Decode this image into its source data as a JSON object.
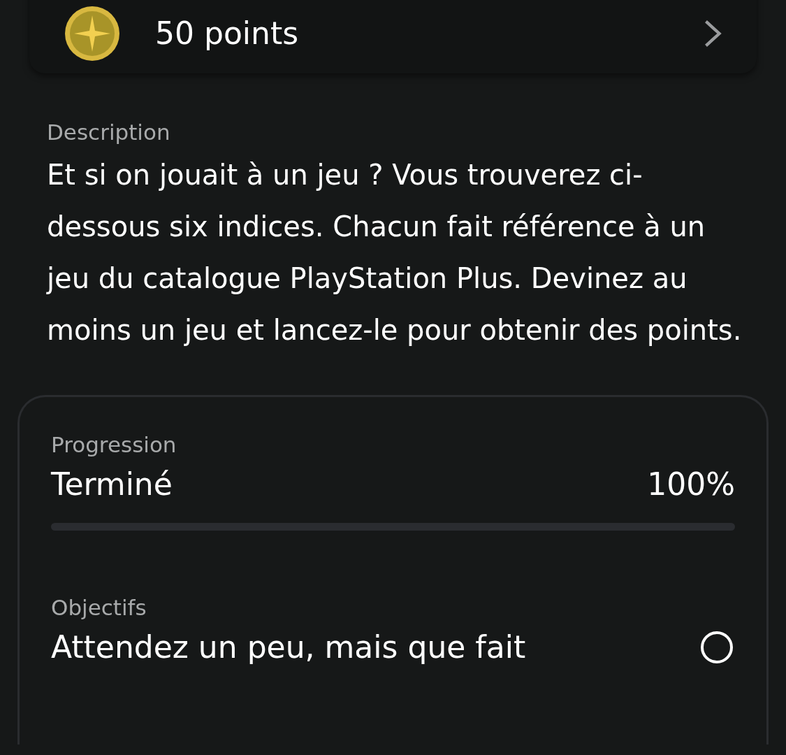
{
  "reward": {
    "value": "50 points"
  },
  "description": {
    "label": "Description",
    "text": "Et si on jouait à un jeu ? Vous trouverez ci-dessous six indices. Chacun fait référence à un jeu du catalogue PlayStation Plus. Devinez au moins un jeu et lancez-le pour obtenir des points."
  },
  "progress": {
    "label": "Progression",
    "status": "Terminé",
    "percent": "100%"
  },
  "objectives": {
    "label": "Objectifs",
    "items": [
      {
        "text": "Attendez un peu, mais que fait",
        "checked": false
      }
    ]
  }
}
